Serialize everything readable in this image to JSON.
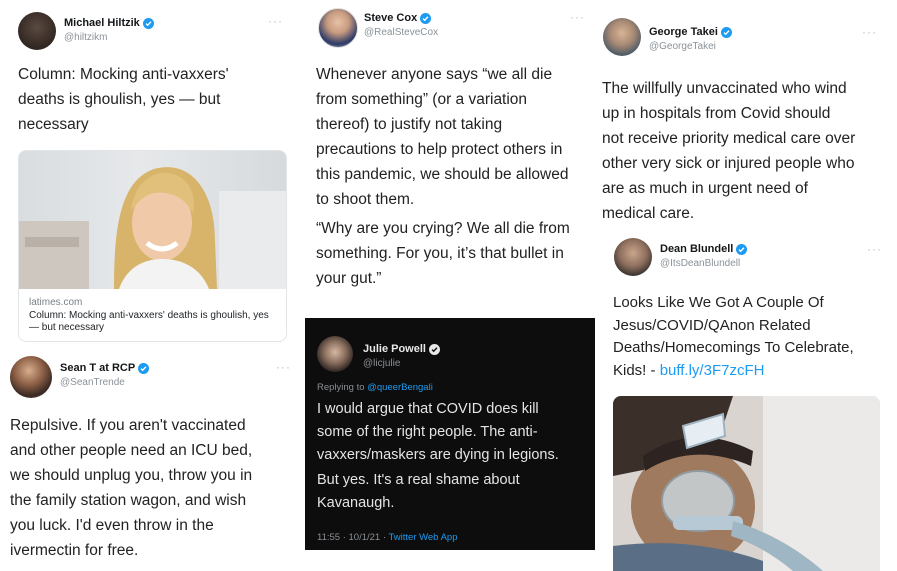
{
  "tweets": {
    "hiltzik": {
      "name": "Michael Hiltzik",
      "handle": "@hiltzikm",
      "more": "···",
      "text": "Column: Mocking anti-vaxxers'\ndeaths is ghoulish, yes — but\nnecessary",
      "card": {
        "domain": "latimes.com",
        "title": "Column: Mocking anti-vaxxers' deaths is ghoulish, yes — but necessary"
      }
    },
    "cox": {
      "name": "Steve Cox",
      "handle": "@RealSteveCox",
      "more": "···",
      "text": "Whenever anyone says “we all die\nfrom something” (or a variation\nthereof) to justify not taking\nprecautions to help protect others in\nthis pandemic, we should be allowed\nto shoot them.",
      "text2": "“Why are you crying? We all die from\nsomething. For you, it’s that bullet in\nyour gut.”"
    },
    "takei": {
      "name": "George Takei",
      "handle": "@GeorgeTakei",
      "more": "···",
      "text": "The willfully unvaccinated who wind\nup in hospitals from Covid should\nnot receive priority medical care over\nother very sick or injured people who\nare as much in urgent need of\nmedical care."
    },
    "blundell": {
      "name": "Dean Blundell",
      "handle": "@ItsDeanBlundell",
      "more": "···",
      "text": "Looks Like We Got A Couple Of\nJesus/COVID/QAnon Related\nDeaths/Homecomings To Celebrate,\nKids! - ",
      "link": "buff.ly/3F7zcFH"
    },
    "trende": {
      "name": "Sean T at RCP",
      "handle": "@SeanTrende",
      "more": "···",
      "text": "Repulsive. If you aren't vaccinated\nand other people need an ICU bed,\nwe should unplug you, throw you in\nthe family station wagon, and wish\nyou luck. I'd even throw in the\nivermectin for free."
    },
    "powell": {
      "name": "Julie Powell",
      "handle": "@licjulie",
      "reply_prefix": "Replying to ",
      "reply_to": "@queerBengali",
      "text": "I would argue that COVID does kill\nsome of the right people. The anti-\nvaxxers/maskers are dying in legions.",
      "text2": "But yes. It's a real shame about\nKavanaugh.",
      "time": "11:55 · 10/1/21 · ",
      "source": "Twitter Web App"
    }
  },
  "colors": {
    "verified": "#1d9bf0",
    "link": "#1d9bf0",
    "dark_bg": "#0d0d0d"
  },
  "icons": [
    "verified-badge-icon",
    "more-options-icon"
  ]
}
